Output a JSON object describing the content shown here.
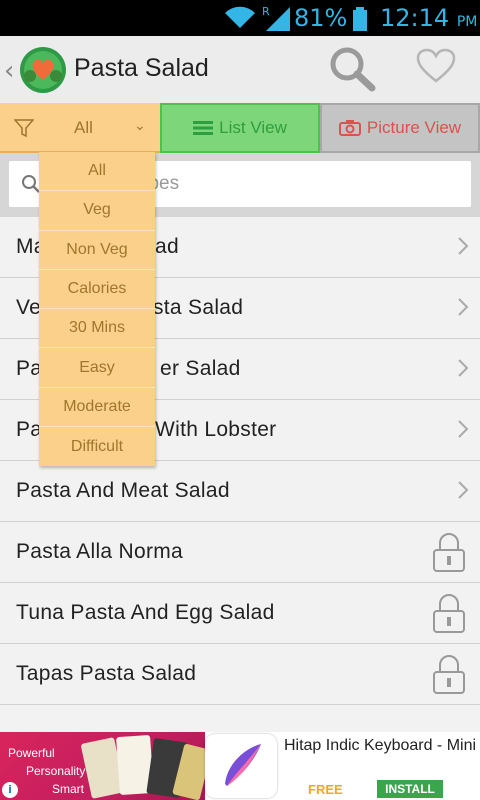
{
  "status_bar": {
    "battery": "81%",
    "time": "12:14",
    "ampm": "PM",
    "signal_letter": "R"
  },
  "app_bar": {
    "title": "Pasta Salad",
    "back_icon": "chevron-left-icon",
    "search_icon": "search-icon",
    "favorite_icon": "heart-icon"
  },
  "tabs": {
    "filter_value": "All",
    "list_view": "List View",
    "picture_view": "Picture View"
  },
  "search": {
    "placeholder": "Search Recipes",
    "visible_fragment": "cipes"
  },
  "filter_dropdown": {
    "options": [
      "All",
      "Veg",
      "Non Veg",
      "Calories",
      "30 Mins",
      "Easy",
      "Moderate",
      "Difficult"
    ]
  },
  "recipes": [
    {
      "label": "Ma",
      "trailing": "chevron",
      "hidden_suffix": "ad"
    },
    {
      "label": "Ve",
      "trailing": "chevron",
      "hidden_suffix": "sta Salad"
    },
    {
      "label": "Pa",
      "trailing": "chevron",
      "hidden_suffix": "er Salad"
    },
    {
      "label": "Pa",
      "trailing": "chevron",
      "hidden_suffix": "With Lobster"
    },
    {
      "label": "Pasta And Meat Salad",
      "trailing": "chevron"
    },
    {
      "label": "Pasta Alla Norma",
      "trailing": "lock"
    },
    {
      "label": "Tuna Pasta And Egg Salad",
      "trailing": "lock"
    },
    {
      "label": "Tapas Pasta Salad",
      "trailing": "lock"
    }
  ],
  "ad": {
    "line1": "Powerful",
    "line2": "Personality",
    "line3": "Smart",
    "app_name": "Hitap Indic Keyboard - Mini",
    "price": "FREE",
    "cta": "INSTALL",
    "info": "i"
  },
  "colors": {
    "filter_tab": "#fbd08a",
    "list_tab": "#7ed67a",
    "picture_tab": "#c4c4c4",
    "status_accent": "#33b5e5"
  }
}
